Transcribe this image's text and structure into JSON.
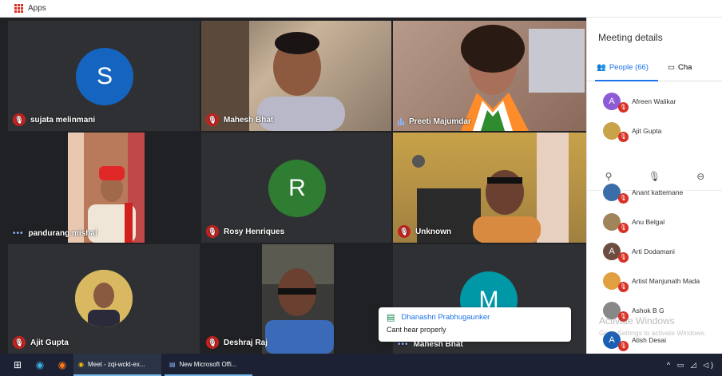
{
  "bookmarks": {
    "apps_label": "Apps"
  },
  "tiles": [
    {
      "name": "sujata melinmani",
      "initial": "S",
      "avatar_color": "#1565c0",
      "status": "muted"
    },
    {
      "name": "Mahesh Bhat",
      "status": "muted"
    },
    {
      "name": "Preeti Majumdar",
      "status": "speaking"
    },
    {
      "name": "pandurang mishal",
      "status": "more"
    },
    {
      "name": "Rosy Henriques",
      "initial": "R",
      "avatar_color": "#2e7d32",
      "status": "muted"
    },
    {
      "name": "Unknown",
      "status": "muted"
    },
    {
      "name": "Ajit Gupta",
      "status": "muted"
    },
    {
      "name": "Deshraj Raj",
      "status": "muted"
    },
    {
      "name": "Mahesh Bhat",
      "initial": "M",
      "avatar_color": "#0097a7",
      "status": "more"
    }
  ],
  "side": {
    "title": "Meeting details",
    "people_tab": "People (66)",
    "chat_tab": "Cha",
    "people_top": [
      {
        "name": "Afreen Walikar",
        "initial": "A",
        "color": "#8e5bd6"
      },
      {
        "name": "Ajit Gupta",
        "initial": "",
        "color": "#c9a24a"
      }
    ],
    "people": [
      {
        "name": "Anant kattemane",
        "initial": "",
        "color": "#3b6ea8"
      },
      {
        "name": "Anu Belgal",
        "initial": "",
        "color": "#a0845c"
      },
      {
        "name": "Arti Dodamani",
        "initial": "A",
        "color": "#6d4c41"
      },
      {
        "name": "Artist Manjunath Mada",
        "initial": "",
        "color": "#e0a040"
      },
      {
        "name": "Ashok B G",
        "initial": "",
        "color": "#888888"
      },
      {
        "name": "Atish Desai",
        "initial": "A",
        "color": "#1a5fb4"
      }
    ]
  },
  "toast": {
    "sender": "Dhanashri Prabhugaunker",
    "message": "Cant hear properly"
  },
  "watermark": {
    "line1": "Activate Windows",
    "line2": "Go to Settings to activate Windows."
  },
  "taskbar": {
    "meet_tab": "Meet - zqi-wckt-ex...",
    "word_tab": "New Microsoft Offi..."
  }
}
